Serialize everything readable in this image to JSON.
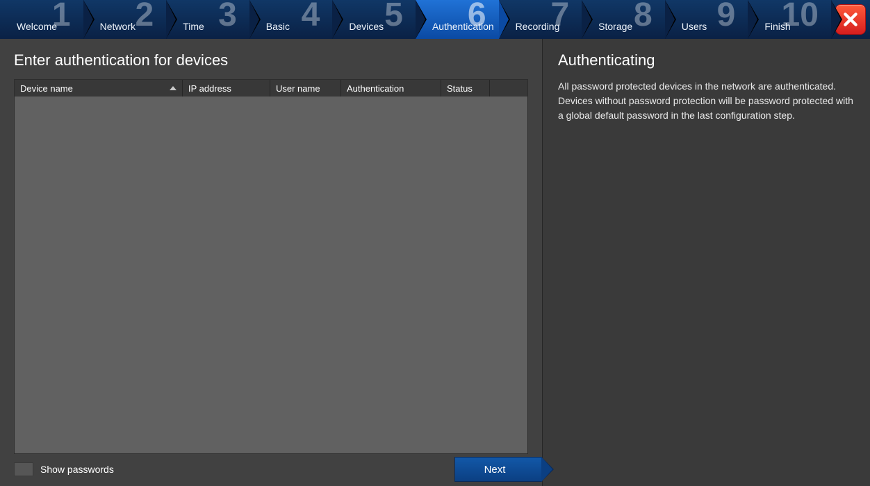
{
  "steps": [
    {
      "num": "1",
      "label": "Welcome"
    },
    {
      "num": "2",
      "label": "Network"
    },
    {
      "num": "3",
      "label": "Time"
    },
    {
      "num": "4",
      "label": "Basic"
    },
    {
      "num": "5",
      "label": "Devices"
    },
    {
      "num": "6",
      "label": "Authentication"
    },
    {
      "num": "7",
      "label": "Recording"
    },
    {
      "num": "8",
      "label": "Storage"
    },
    {
      "num": "9",
      "label": "Users"
    },
    {
      "num": "10",
      "label": "Finish"
    }
  ],
  "active_step_index": 5,
  "left": {
    "title": "Enter authentication for devices",
    "columns": {
      "device_name": "Device name",
      "ip_address": "IP address",
      "user_name": "User name",
      "authentication": "Authentication",
      "status": "Status"
    },
    "rows": [],
    "show_passwords_label": "Show passwords",
    "show_passwords_checked": false,
    "next_label": "Next"
  },
  "right": {
    "title": "Authenticating",
    "body": "All password protected devices in the network are authenticated. Devices without password protection will be password protected with a global default password in the last configuration step."
  }
}
